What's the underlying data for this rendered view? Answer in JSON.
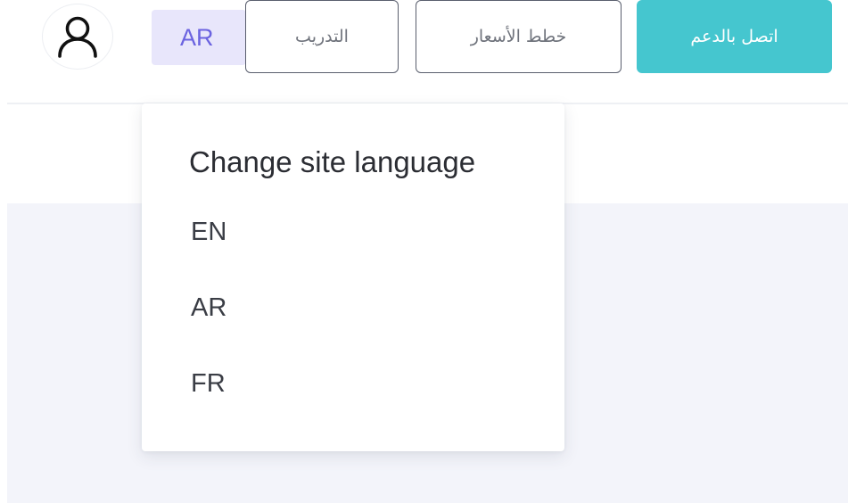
{
  "header": {
    "language_button": "AR",
    "training_button": "التدريب",
    "pricing_button": "خطط الأسعار",
    "support_button": "اتصل بالدعم",
    "avatar_icon": "user-icon"
  },
  "language_menu": {
    "title": "Change site language",
    "options": [
      "EN",
      "AR",
      "FR"
    ]
  },
  "colors": {
    "accent": "#45c6cf",
    "language_badge_bg": "#e8e6fb",
    "language_badge_text": "#6b63e0",
    "content_band": "#f3f4fa"
  }
}
